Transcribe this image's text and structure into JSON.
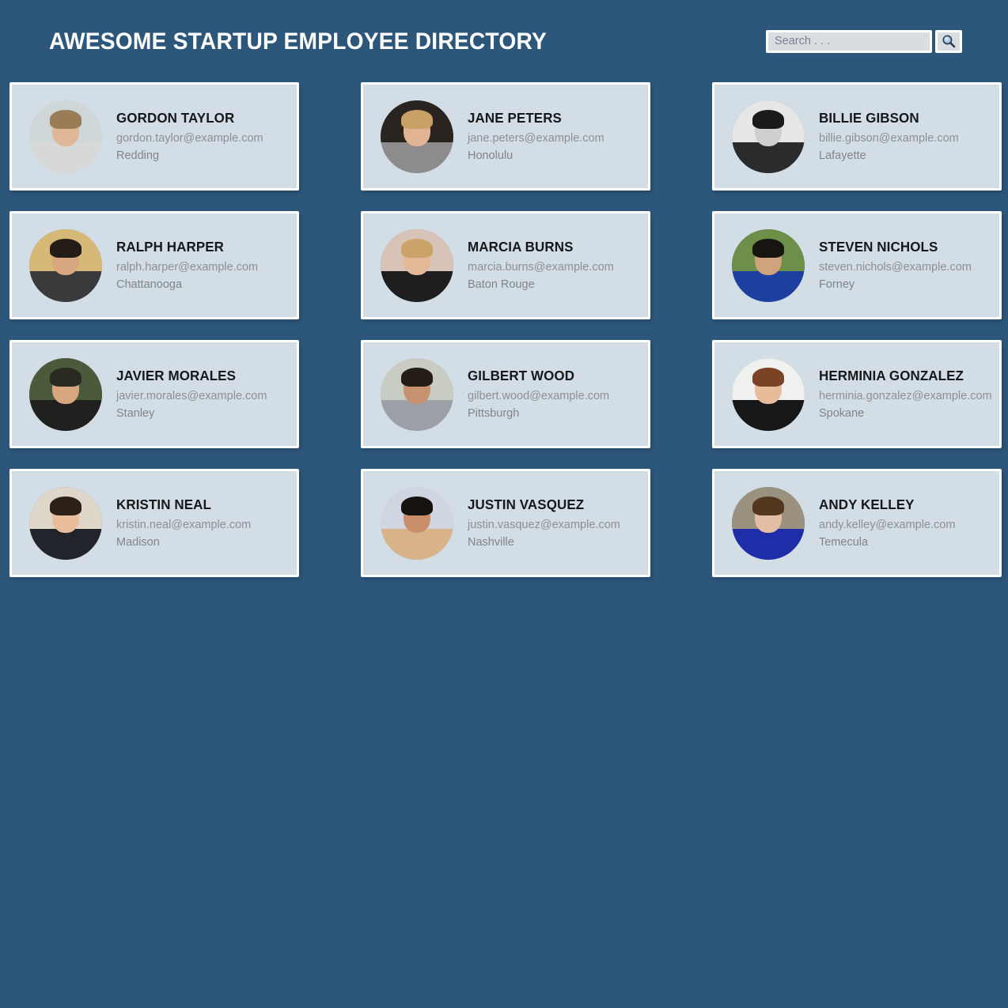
{
  "header": {
    "title": "AWESOME STARTUP EMPLOYEE DIRECTORY",
    "search": {
      "placeholder": "Search . . .",
      "value": "",
      "button_icon": "search-icon"
    }
  },
  "colors": {
    "page_background": "#2d577a",
    "card_background": "#d2dde5",
    "card_border": "#ffffff",
    "title_text": "#ffffff",
    "name_text": "#16181a",
    "meta_text": "#8a9196",
    "search_field_background": "#d7dde1"
  },
  "employees": [
    {
      "name": "GORDON TAYLOR",
      "email": "gordon.taylor@example.com",
      "city": "Redding",
      "avatar": {
        "alt": "gordon-taylor-avatar",
        "sky": "#cfd6d8",
        "body": "#d7d9d9",
        "skin": "#e0b796",
        "hair": "#9a7c57"
      }
    },
    {
      "name": "JANE PETERS",
      "email": "jane.peters@example.com",
      "city": "Honolulu",
      "avatar": {
        "alt": "jane-peters-avatar",
        "sky": "#2a2420",
        "body": "#8e8b8d",
        "skin": "#e2b494",
        "hair": "#c9a066"
      }
    },
    {
      "name": "BILLIE GIBSON",
      "email": "billie.gibson@example.com",
      "city": "Lafayette",
      "avatar": {
        "alt": "billie-gibson-avatar",
        "sky": "#e6e6e6",
        "body": "#2b2b2b",
        "skin": "#cfcfcf",
        "hair": "#1a1a1a"
      }
    },
    {
      "name": "RALPH HARPER",
      "email": "ralph.harper@example.com",
      "city": "Chattanooga",
      "avatar": {
        "alt": "ralph-harper-avatar",
        "sky": "#d6b877",
        "body": "#3a3a3c",
        "skin": "#d8a77f",
        "hair": "#241c16"
      }
    },
    {
      "name": "MARCIA BURNS",
      "email": "marcia.burns@example.com",
      "city": "Baton Rouge",
      "avatar": {
        "alt": "marcia-burns-avatar",
        "sky": "#d7c3b8",
        "body": "#1f1d1e",
        "skin": "#e3b896",
        "hair": "#caa36a"
      }
    },
    {
      "name": "STEVEN NICHOLS",
      "email": "steven.nichols@example.com",
      "city": "Forney",
      "avatar": {
        "alt": "steven-nichols-avatar",
        "sky": "#6d8f4a",
        "body": "#1c3fa0",
        "skin": "#cfa37d",
        "hair": "#181410"
      }
    },
    {
      "name": "JAVIER MORALES",
      "email": "javier.morales@example.com",
      "city": "Stanley",
      "avatar": {
        "alt": "javier-morales-avatar",
        "sky": "#4b5a3a",
        "body": "#20201e",
        "skin": "#d9a682",
        "hair": "#2b2a22"
      }
    },
    {
      "name": "GILBERT WOOD",
      "email": "gilbert.wood@example.com",
      "city": "Pittsburgh",
      "avatar": {
        "alt": "gilbert-wood-avatar",
        "sky": "#c8ccc2",
        "body": "#9aa0a6",
        "skin": "#c89270",
        "hair": "#241d18"
      }
    },
    {
      "name": "HERMINIA GONZALEZ",
      "email": "herminia.gonzalez@example.com",
      "city": "Spokane",
      "avatar": {
        "alt": "herminia-gonzalez-avatar",
        "sky": "#f0f0ee",
        "body": "#171717",
        "skin": "#e8bb9a",
        "hair": "#7a4326"
      }
    },
    {
      "name": "KRISTIN NEAL",
      "email": "kristin.neal@example.com",
      "city": "Madison",
      "avatar": {
        "alt": "kristin-neal-avatar",
        "sky": "#ded6c9",
        "body": "#22242c",
        "skin": "#e9bc9b",
        "hair": "#2c2018"
      }
    },
    {
      "name": "JUSTIN VASQUEZ",
      "email": "justin.vasquez@example.com",
      "city": "Nashville",
      "avatar": {
        "alt": "justin-vasquez-avatar",
        "sky": "#cfd6e2",
        "body": "#d8b389",
        "skin": "#c98f6a",
        "hair": "#16120f"
      }
    },
    {
      "name": "ANDY KELLEY",
      "email": "andy.kelley@example.com",
      "city": "Temecula",
      "avatar": {
        "alt": "andy-kelley-avatar",
        "sky": "#9a927f",
        "body": "#1f2ea8",
        "skin": "#e3bda4",
        "hair": "#53381f"
      }
    }
  ]
}
